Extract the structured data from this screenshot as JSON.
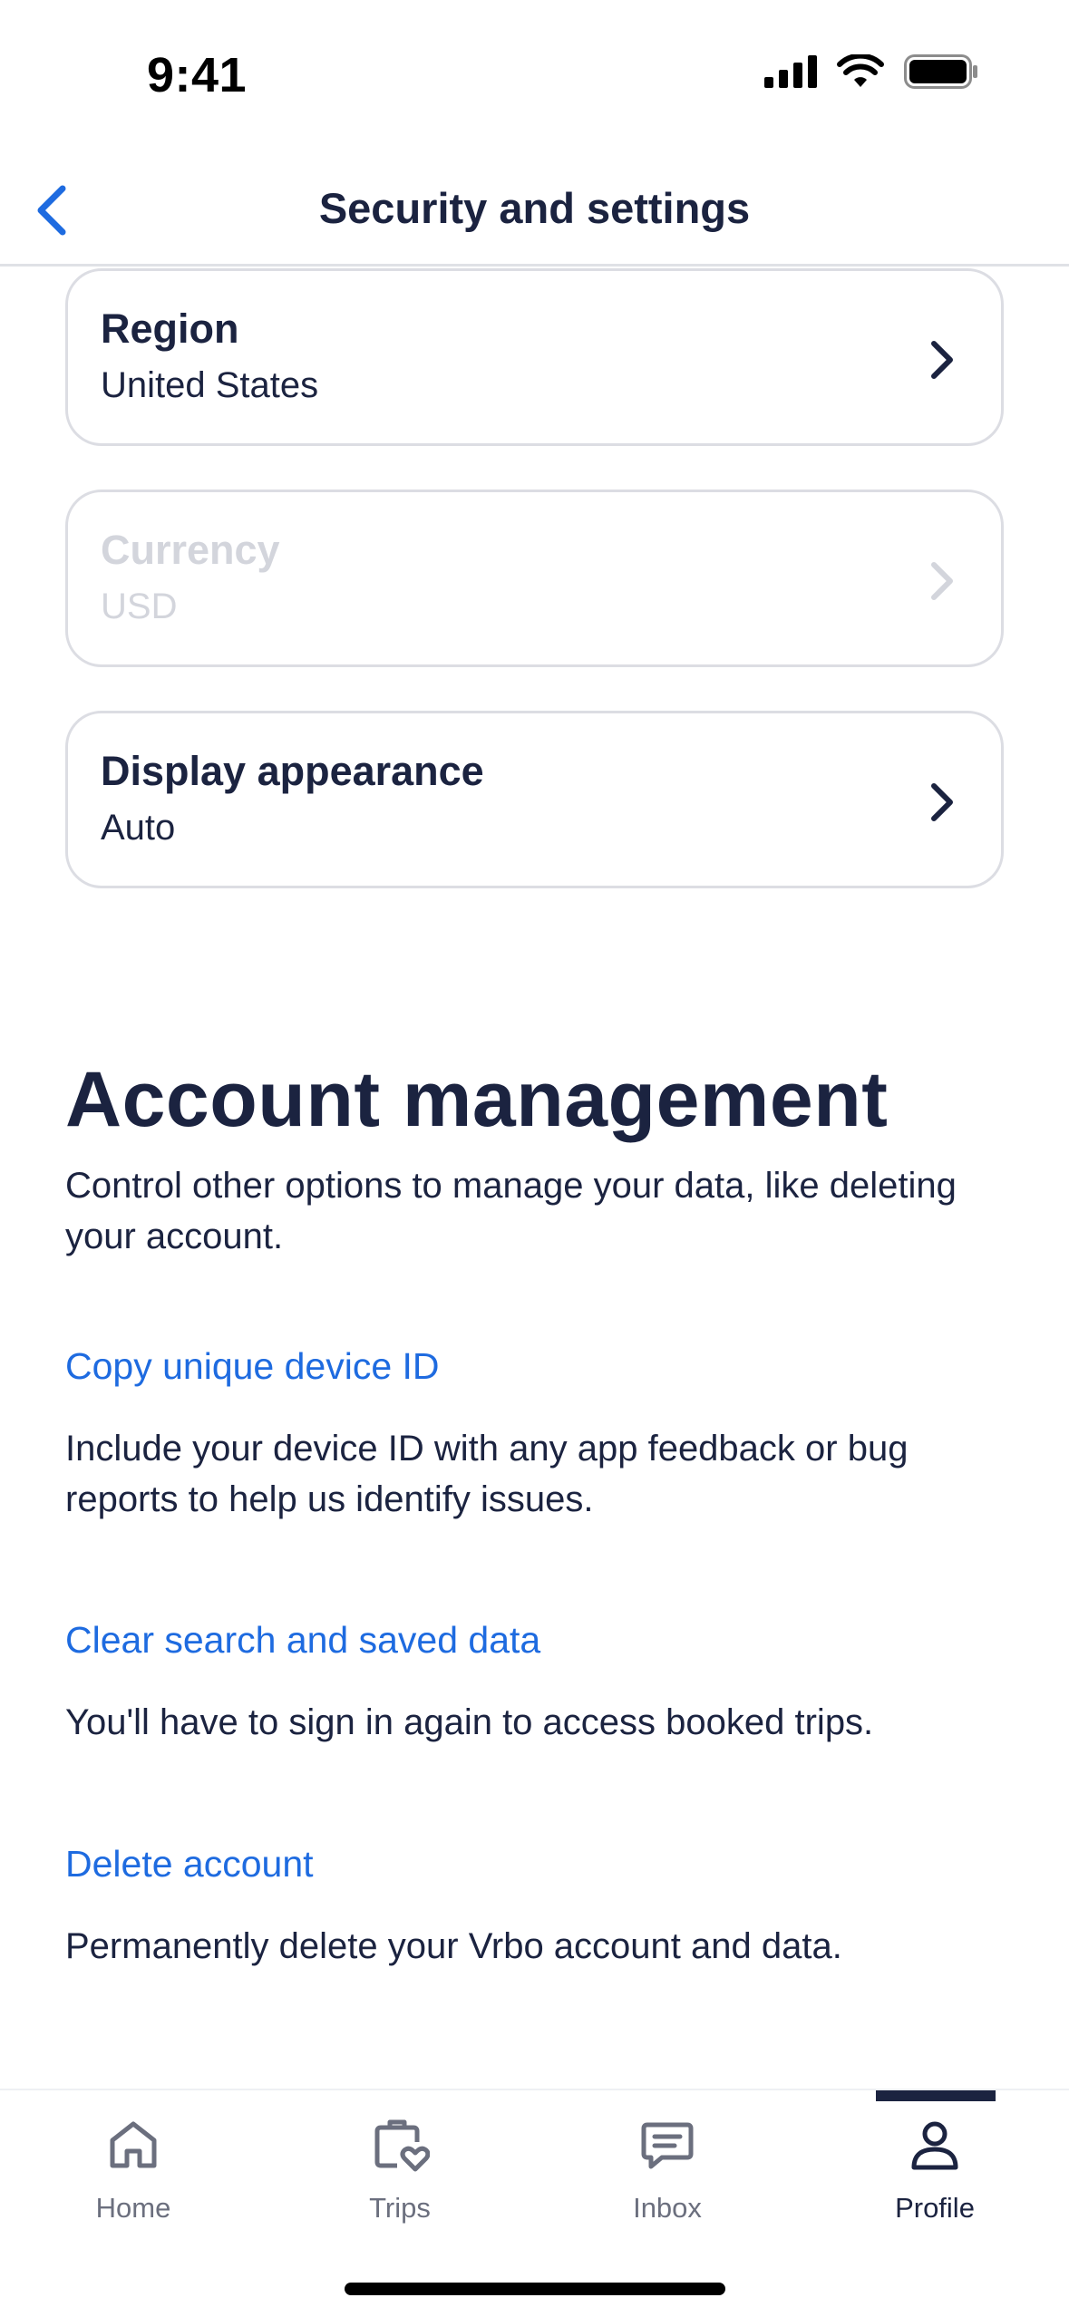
{
  "status_bar": {
    "time": "9:41"
  },
  "header": {
    "title": "Security and settings",
    "back_icon": "chevron-left-icon"
  },
  "settings_cards": [
    {
      "title": "Region",
      "value": "United States",
      "enabled": true
    },
    {
      "title": "Currency",
      "value": "USD",
      "enabled": false
    },
    {
      "title": "Display appearance",
      "value": "Auto",
      "enabled": true
    }
  ],
  "account_management": {
    "title": "Account management",
    "description": "Control other options to manage your data, like deleting your account.",
    "items": [
      {
        "link": "Copy unique device ID",
        "text": "Include your device ID with any app feedback or bug reports to help us identify issues."
      },
      {
        "link": "Clear search and saved data",
        "text": "You'll have to sign in again to access booked trips."
      },
      {
        "link": "Delete account",
        "text": "Permanently delete your Vrbo account and data."
      }
    ]
  },
  "tab_bar": {
    "tabs": [
      {
        "label": "Home",
        "icon": "home-icon",
        "active": false
      },
      {
        "label": "Trips",
        "icon": "trips-suitcase-heart-icon",
        "active": false
      },
      {
        "label": "Inbox",
        "icon": "inbox-message-icon",
        "active": false
      },
      {
        "label": "Profile",
        "icon": "profile-person-icon",
        "active": true
      }
    ]
  },
  "colors": {
    "text_primary": "#1b2340",
    "link": "#1e6be0",
    "disabled_text": "#d3d5dc",
    "card_border": "#dcdde3",
    "tab_inactive": "#6b6f7e"
  }
}
